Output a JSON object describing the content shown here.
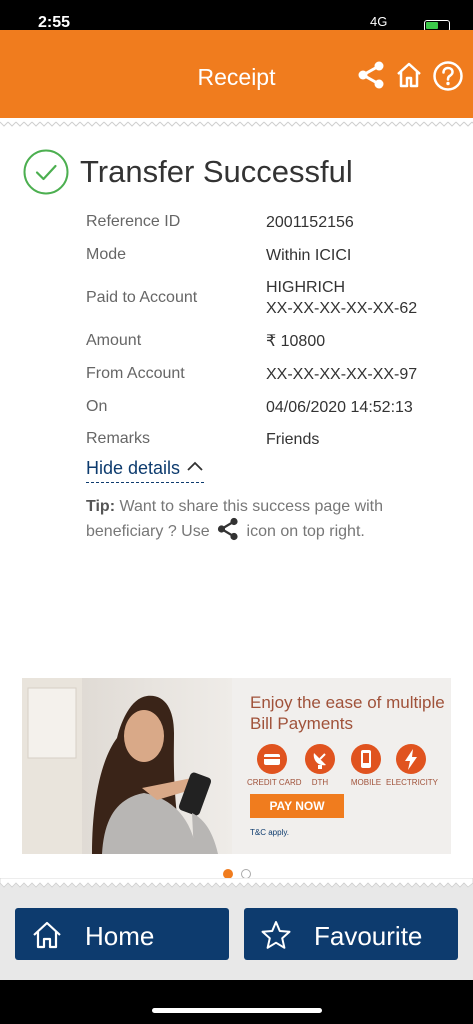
{
  "status_bar": {
    "time": "2:55",
    "network": "4G"
  },
  "header": {
    "title": "Receipt",
    "icons": [
      "share-icon",
      "home-icon",
      "help-icon"
    ]
  },
  "success": {
    "title": "Transfer Successful",
    "icon": "check-circle-icon",
    "color": "#4caf50"
  },
  "details": [
    {
      "label": "Reference ID",
      "value": "2001152156"
    },
    {
      "label": "Mode",
      "value": "Within ICICI"
    },
    {
      "label": "Paid to Account",
      "value": "HIGHRICH",
      "value2": "XX-XX-XX-XX-XX-62"
    },
    {
      "label": "Amount",
      "value": "₹ 10800"
    },
    {
      "label": "From Account",
      "value": "XX-XX-XX-XX-XX-97"
    },
    {
      "label": "On",
      "value": "04/06/2020 14:52:13"
    },
    {
      "label": "Remarks",
      "value": "Friends"
    }
  ],
  "hide_details_label": "Hide details",
  "tip": {
    "label": "Tip:",
    "text_before": "Want to share this success page with beneficiary ? Use",
    "text_after": "icon on top right."
  },
  "banner": {
    "headline": "Enjoy the ease of multiple Bill Payments",
    "categories": [
      "CREDIT CARD",
      "DTH",
      "MOBILE",
      "ELECTRICITY"
    ],
    "cta": "PAY NOW",
    "tnc": "T&C apply."
  },
  "carousel": {
    "pages": 2,
    "active": 1
  },
  "bottom_nav": {
    "home_label": "Home",
    "favourite_label": "Favourite"
  },
  "colors": {
    "brand_orange": "#f07c1e",
    "brand_navy": "#0d3b6e",
    "success_green": "#4caf50"
  }
}
